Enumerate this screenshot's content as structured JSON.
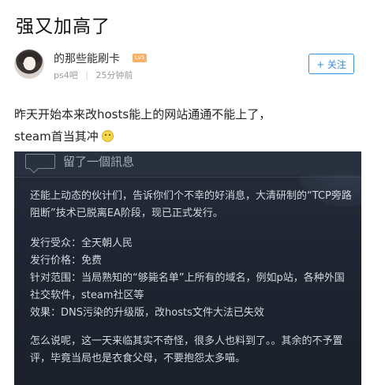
{
  "post": {
    "title": "强又加高了",
    "author": {
      "name": "的那些能刷卡",
      "level_badge": "Lv5",
      "forum": "ps4吧",
      "time": "25分钟前"
    },
    "follow_label": "+ 关注",
    "content_line1": "昨天开始本来改hosts能上的网站通通不能上了，",
    "content_line2": "steam首当其冲"
  },
  "screenshot": {
    "header_title": "留了一個訊息",
    "paragraph1": "还能上动态的伙计们，告诉你们个不幸的好消息，大清研制的“TCP旁路阻断”技术已脱离EA阶段，现已正式发行。",
    "info_lines": [
      "发行受众：全天朝人民",
      "发行价格：免费",
      "针对范围：当局熟知的“够毙名单”上所有的域名，例如p站，各种外国社交软件，steam社区等",
      "效果：DNS污染的升级版，改hosts文件大法已失效"
    ],
    "paragraph3": "怎么说呢，这一天来临其实不奇怪，很多人也料到了。。其余的不予置评，毕竟当局也是衣食父母，不要抱怨太多喵。"
  },
  "icons": {
    "avatar": "anime-girl-avatar",
    "emoji": "grimace-emoji",
    "chat": "speech-bubble-icon"
  },
  "colors": {
    "accent": "#3b8de0",
    "screenshot_bg": "#1f2532",
    "screenshot_text": "#d2d8df"
  }
}
